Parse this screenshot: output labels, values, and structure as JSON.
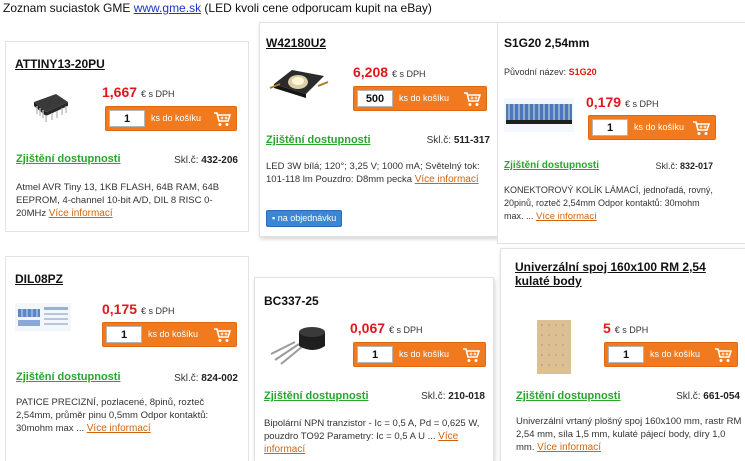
{
  "header": {
    "prefix": "Zoznam suciastok GME ",
    "link": "www.gme.sk",
    "suffix": " (LED kvoli cene odporucam kupit na eBay)"
  },
  "common": {
    "dph": "€ s DPH",
    "cart_label": "ks do košíku",
    "avail": "Zjištění dostupnosti",
    "skl_prefix": "Skl.č:",
    "more": "Více informací"
  },
  "products": [
    {
      "name": "ATTINY13-20PU",
      "price": "1,667",
      "qty": "1",
      "skl": "432-206",
      "desc": "Atmel AVR Tiny 13, 1KB FLASH, 64B RAM, 64B EEPROM, 4-channel 10-bit A/D, DIL 8 RISC 0-20MHz "
    },
    {
      "name": "W42180U2",
      "price": "6,208",
      "qty": "500",
      "skl": "511-317",
      "desc": "LED 3W bílá; 120°; 3,25 V; 1000 mA; Světelný tok: 101-118 lm Pouzdro: D8mm pecka ",
      "order_label": "na objednávku"
    },
    {
      "name": "S1G20 2,54mm",
      "price": "0,179",
      "qty": "1",
      "skl": "832-017",
      "orig_label": "Původní název:",
      "orig_value": "S1G20",
      "desc": "KONEKTOROVÝ KOLÍK LÁMACÍ, jednořadá, rovný, 20pinů, rozteč 2,54mm Odpor kontaktů: 30mohm max. ... "
    },
    {
      "name": "DIL08PZ",
      "price": "0,175",
      "qty": "1",
      "skl": "824-002",
      "desc": "PATICE PRECIZNÍ, pozlacené, 8pinů, rozteč 2,54mm, průměr pinu 0,5mm Odpor kontaktů: 30mohm max ... "
    },
    {
      "name": "BC337-25",
      "price": "0,067",
      "qty": "1",
      "skl": "210-018",
      "desc": "Bipolární NPN tranzistor - Ic = 0,5 A, Pd = 0,625 W, pouzdro TO92 Parametry: Ic = 0,5 A U ... "
    },
    {
      "name": "Univerzální spoj 160x100 RM 2,54 kulaté body",
      "price": "5",
      "qty": "1",
      "skl": "661-054",
      "desc": "Univerzální vrtaný plošný spoj 160x100 mm, rastr RM 2,54 mm, síla 1,5 mm, kulaté pájecí body, díry 1,0 mm. "
    }
  ]
}
